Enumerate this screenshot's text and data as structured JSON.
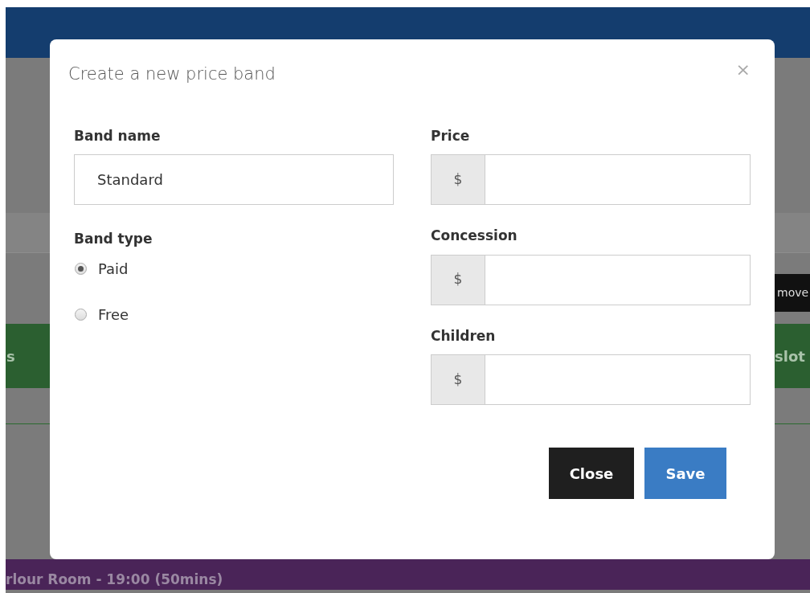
{
  "background": {
    "move_button": "move",
    "green_bar_left": "s",
    "green_bar_right": "slot",
    "purple_bar": "rlour Room - 19:00 (50mins)"
  },
  "dialog": {
    "title": "Create a new price band",
    "close_icon": "×",
    "band_name": {
      "label": "Band name",
      "value": "Standard"
    },
    "band_type": {
      "label": "Band type",
      "options": [
        {
          "label": "Paid",
          "selected": true
        },
        {
          "label": "Free",
          "selected": false
        }
      ]
    },
    "prices": [
      {
        "label": "Price",
        "prefix": "$"
      },
      {
        "label": "Concession",
        "prefix": "$"
      },
      {
        "label": "Children",
        "prefix": "$"
      }
    ],
    "buttons": [
      {
        "label": "Close",
        "kind": "dark"
      },
      {
        "label": "Save",
        "kind": "primary"
      }
    ]
  }
}
